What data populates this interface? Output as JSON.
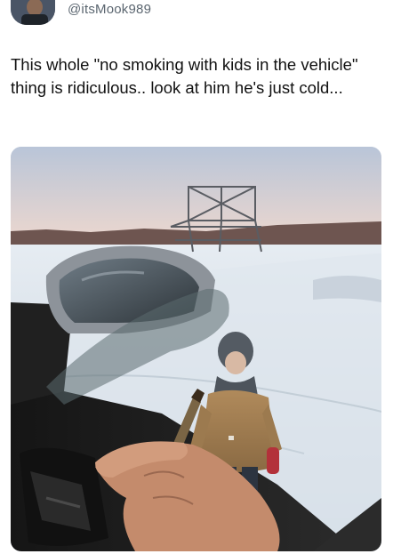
{
  "post": {
    "handle": "@itsMook989",
    "text": "This whole \"no smoking with kids in the vehicle\" thing is ridiculous.. look at him he's just cold...",
    "media": {
      "icon": "photo-icon"
    }
  }
}
